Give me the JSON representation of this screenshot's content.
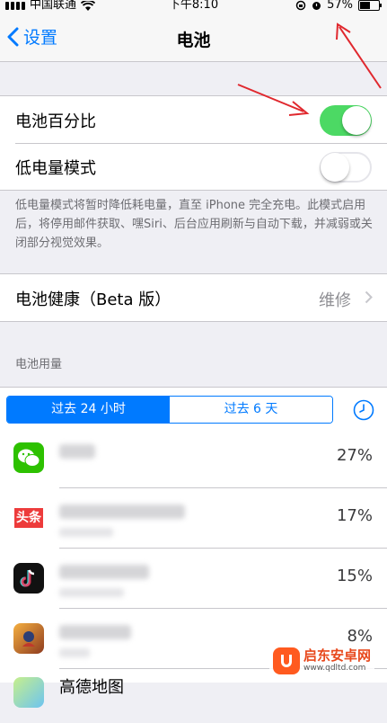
{
  "status": {
    "carrier": "中国联通",
    "time": "下午8:10",
    "battery_pct": "57%",
    "battery_level": 0.57
  },
  "nav": {
    "back_label": "设置",
    "title": "电池"
  },
  "settings": {
    "battery_percentage": {
      "label": "电池百分比",
      "on": true
    },
    "low_power_mode": {
      "label": "低电量模式",
      "on": false
    },
    "footnote": "低电量模式将暂时降低耗电量，直至 iPhone 完全充电。此模式启用后，将停用邮件获取、嘿Siri、后台应用刷新与自动下载，并减弱或关闭部分视觉效果。"
  },
  "battery_health": {
    "label": "电池健康（Beta 版）",
    "value": "维修"
  },
  "usage": {
    "section_title": "电池用量",
    "tabs": [
      "过去 24 小时",
      "过去 6 天"
    ],
    "active_tab": 0,
    "apps": [
      {
        "icon": "wechat-icon",
        "name": "",
        "percent": "27%"
      },
      {
        "icon": "toutiao-icon",
        "icon_text": "头条",
        "name": "",
        "percent": "17%"
      },
      {
        "icon": "douyin-icon",
        "name": "",
        "percent": "15%"
      },
      {
        "icon": "game-icon",
        "name": "",
        "percent": "8%"
      },
      {
        "icon": "amap-icon",
        "name": "高德地图",
        "percent": ""
      }
    ]
  },
  "colors": {
    "accent": "#007aff",
    "toggle_on": "#4cd964",
    "background": "#efeff4",
    "annotation_arrow": "#e0282e"
  },
  "watermark": {
    "title": "启东安卓网",
    "url": "www.qdltd.com"
  }
}
